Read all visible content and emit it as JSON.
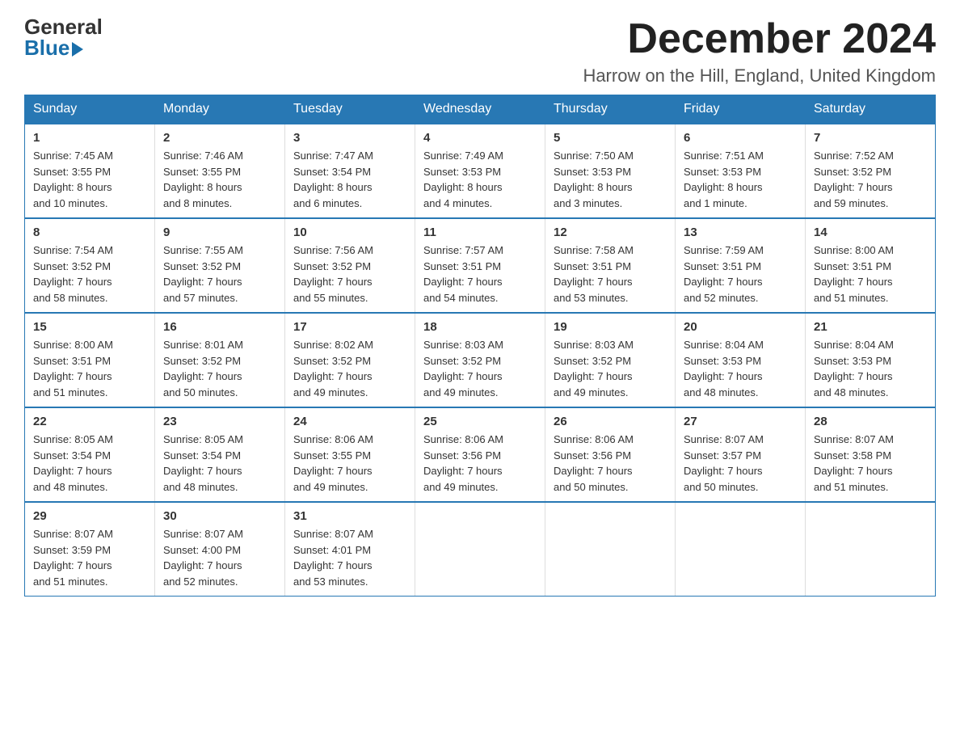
{
  "logo": {
    "general": "General",
    "blue": "Blue"
  },
  "header": {
    "month": "December 2024",
    "location": "Harrow on the Hill, England, United Kingdom"
  },
  "weekdays": [
    "Sunday",
    "Monday",
    "Tuesday",
    "Wednesday",
    "Thursday",
    "Friday",
    "Saturday"
  ],
  "weeks": [
    [
      {
        "day": "1",
        "sunrise": "7:45 AM",
        "sunset": "3:55 PM",
        "daylight": "8 hours and 10 minutes."
      },
      {
        "day": "2",
        "sunrise": "7:46 AM",
        "sunset": "3:55 PM",
        "daylight": "8 hours and 8 minutes."
      },
      {
        "day": "3",
        "sunrise": "7:47 AM",
        "sunset": "3:54 PM",
        "daylight": "8 hours and 6 minutes."
      },
      {
        "day": "4",
        "sunrise": "7:49 AM",
        "sunset": "3:53 PM",
        "daylight": "8 hours and 4 minutes."
      },
      {
        "day": "5",
        "sunrise": "7:50 AM",
        "sunset": "3:53 PM",
        "daylight": "8 hours and 3 minutes."
      },
      {
        "day": "6",
        "sunrise": "7:51 AM",
        "sunset": "3:53 PM",
        "daylight": "8 hours and 1 minute."
      },
      {
        "day": "7",
        "sunrise": "7:52 AM",
        "sunset": "3:52 PM",
        "daylight": "7 hours and 59 minutes."
      }
    ],
    [
      {
        "day": "8",
        "sunrise": "7:54 AM",
        "sunset": "3:52 PM",
        "daylight": "7 hours and 58 minutes."
      },
      {
        "day": "9",
        "sunrise": "7:55 AM",
        "sunset": "3:52 PM",
        "daylight": "7 hours and 57 minutes."
      },
      {
        "day": "10",
        "sunrise": "7:56 AM",
        "sunset": "3:52 PM",
        "daylight": "7 hours and 55 minutes."
      },
      {
        "day": "11",
        "sunrise": "7:57 AM",
        "sunset": "3:51 PM",
        "daylight": "7 hours and 54 minutes."
      },
      {
        "day": "12",
        "sunrise": "7:58 AM",
        "sunset": "3:51 PM",
        "daylight": "7 hours and 53 minutes."
      },
      {
        "day": "13",
        "sunrise": "7:59 AM",
        "sunset": "3:51 PM",
        "daylight": "7 hours and 52 minutes."
      },
      {
        "day": "14",
        "sunrise": "8:00 AM",
        "sunset": "3:51 PM",
        "daylight": "7 hours and 51 minutes."
      }
    ],
    [
      {
        "day": "15",
        "sunrise": "8:00 AM",
        "sunset": "3:51 PM",
        "daylight": "7 hours and 51 minutes."
      },
      {
        "day": "16",
        "sunrise": "8:01 AM",
        "sunset": "3:52 PM",
        "daylight": "7 hours and 50 minutes."
      },
      {
        "day": "17",
        "sunrise": "8:02 AM",
        "sunset": "3:52 PM",
        "daylight": "7 hours and 49 minutes."
      },
      {
        "day": "18",
        "sunrise": "8:03 AM",
        "sunset": "3:52 PM",
        "daylight": "7 hours and 49 minutes."
      },
      {
        "day": "19",
        "sunrise": "8:03 AM",
        "sunset": "3:52 PM",
        "daylight": "7 hours and 49 minutes."
      },
      {
        "day": "20",
        "sunrise": "8:04 AM",
        "sunset": "3:53 PM",
        "daylight": "7 hours and 48 minutes."
      },
      {
        "day": "21",
        "sunrise": "8:04 AM",
        "sunset": "3:53 PM",
        "daylight": "7 hours and 48 minutes."
      }
    ],
    [
      {
        "day": "22",
        "sunrise": "8:05 AM",
        "sunset": "3:54 PM",
        "daylight": "7 hours and 48 minutes."
      },
      {
        "day": "23",
        "sunrise": "8:05 AM",
        "sunset": "3:54 PM",
        "daylight": "7 hours and 48 minutes."
      },
      {
        "day": "24",
        "sunrise": "8:06 AM",
        "sunset": "3:55 PM",
        "daylight": "7 hours and 49 minutes."
      },
      {
        "day": "25",
        "sunrise": "8:06 AM",
        "sunset": "3:56 PM",
        "daylight": "7 hours and 49 minutes."
      },
      {
        "day": "26",
        "sunrise": "8:06 AM",
        "sunset": "3:56 PM",
        "daylight": "7 hours and 50 minutes."
      },
      {
        "day": "27",
        "sunrise": "8:07 AM",
        "sunset": "3:57 PM",
        "daylight": "7 hours and 50 minutes."
      },
      {
        "day": "28",
        "sunrise": "8:07 AM",
        "sunset": "3:58 PM",
        "daylight": "7 hours and 51 minutes."
      }
    ],
    [
      {
        "day": "29",
        "sunrise": "8:07 AM",
        "sunset": "3:59 PM",
        "daylight": "7 hours and 51 minutes."
      },
      {
        "day": "30",
        "sunrise": "8:07 AM",
        "sunset": "4:00 PM",
        "daylight": "7 hours and 52 minutes."
      },
      {
        "day": "31",
        "sunrise": "8:07 AM",
        "sunset": "4:01 PM",
        "daylight": "7 hours and 53 minutes."
      },
      null,
      null,
      null,
      null
    ]
  ]
}
